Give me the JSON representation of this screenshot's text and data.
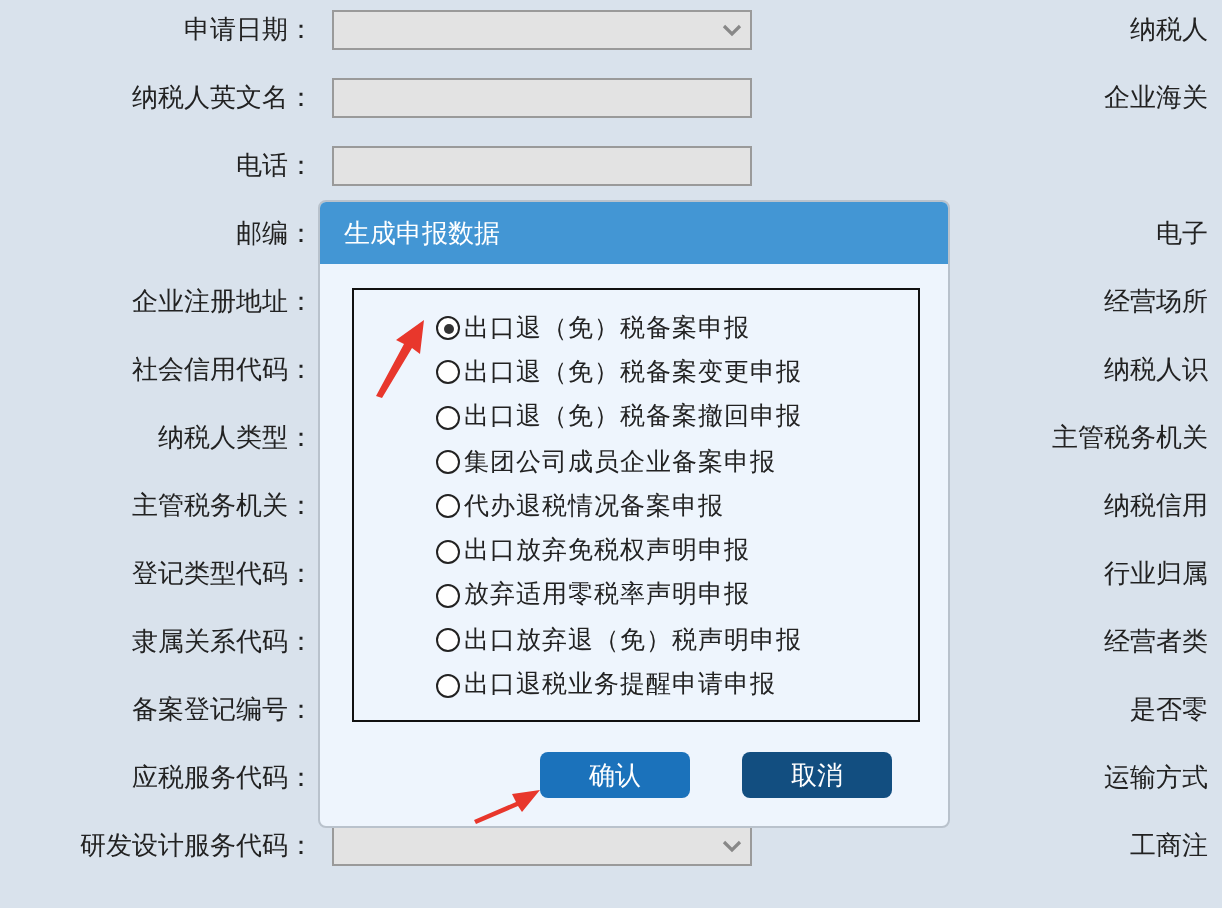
{
  "form": {
    "left_rows": [
      {
        "label": "申请日期：",
        "kind": "select"
      },
      {
        "label": "纳税人英文名：",
        "kind": "input"
      },
      {
        "label": "电话：",
        "kind": "input"
      },
      {
        "label": "邮编：",
        "kind": "covered"
      },
      {
        "label": "企业注册地址：",
        "kind": "covered"
      },
      {
        "label": "社会信用代码：",
        "kind": "covered"
      },
      {
        "label": "纳税人类型：",
        "kind": "covered"
      },
      {
        "label": "主管税务机关：",
        "kind": "covered"
      },
      {
        "label": "登记类型代码：",
        "kind": "covered"
      },
      {
        "label": "隶属关系代码：",
        "kind": "covered"
      },
      {
        "label": "备案登记编号：",
        "kind": "covered"
      },
      {
        "label": "应税服务代码：",
        "kind": "covered"
      },
      {
        "label": "研发设计服务代码：",
        "kind": "select"
      }
    ],
    "right_rows": [
      {
        "kind": "label",
        "label": "纳税人"
      },
      {
        "kind": "label",
        "label": "企业海关"
      },
      {
        "kind": "blank"
      },
      {
        "kind": "label",
        "label": "电子"
      },
      {
        "kind": "label",
        "label": "经营场所"
      },
      {
        "kind": "label",
        "label": "纳税人识"
      },
      {
        "kind": "label",
        "label": "主管税务机关"
      },
      {
        "kind": "label",
        "label": "纳税信用"
      },
      {
        "kind": "label",
        "label": "行业归属"
      },
      {
        "kind": "label",
        "label": "经营者类"
      },
      {
        "kind": "label",
        "label": "是否零"
      },
      {
        "kind": "label",
        "label": "运输方式"
      },
      {
        "kind": "label",
        "label": "工商注"
      }
    ]
  },
  "dialog": {
    "title": "生成申报数据",
    "options": [
      {
        "label": "出口退（免）税备案申报",
        "selected": true
      },
      {
        "label": "出口退（免）税备案变更申报",
        "selected": false
      },
      {
        "label": "出口退（免）税备案撤回申报",
        "selected": false
      },
      {
        "label": "集团公司成员企业备案申报",
        "selected": false
      },
      {
        "label": "代办退税情况备案申报",
        "selected": false
      },
      {
        "label": "出口放弃免税权声明申报",
        "selected": false
      },
      {
        "label": "放弃适用零税率声明申报",
        "selected": false
      },
      {
        "label": "出口放弃退（免）税声明申报",
        "selected": false
      },
      {
        "label": "出口退税业务提醒申请申报",
        "selected": false
      }
    ],
    "buttons": [
      {
        "label": "确认",
        "kind": "primary"
      },
      {
        "label": "取消",
        "kind": "secondary"
      }
    ]
  }
}
